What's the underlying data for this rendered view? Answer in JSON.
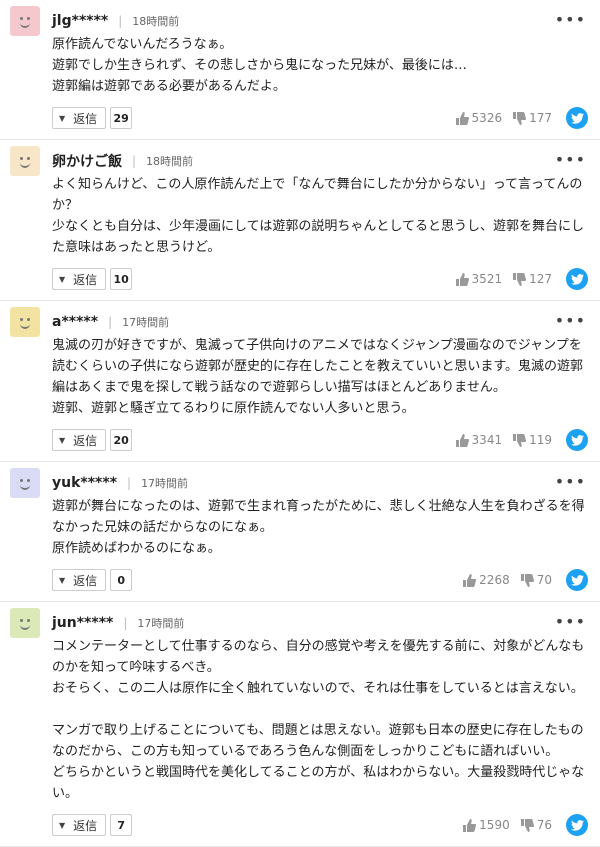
{
  "comments": [
    {
      "user": "jlg*****",
      "time": "18時間前",
      "avatar_color": "#f4c8cc",
      "body": "原作読んでないんだろうなぁ。\n遊郭でしか生きられず、その悲しさから鬼になった兄妹が、最後には…\n遊郭編は遊郭である必要があるんだよ。",
      "reply_label": "返信",
      "reply_count": "29",
      "likes": "5326",
      "dislikes": "177"
    },
    {
      "user": "卵かけご飯",
      "time": "18時間前",
      "avatar_color": "#f7e6c8",
      "body": "よく知らんけど、この人原作読んだ上で「なんで舞台にしたか分からない」って言ってんのか？\n少なくとも自分は、少年漫画にしては遊郭の説明ちゃんとしてると思うし、遊郭を舞台にした意味はあったと思うけど。",
      "reply_label": "返信",
      "reply_count": "10",
      "likes": "3521",
      "dislikes": "127"
    },
    {
      "user": "a*****",
      "time": "17時間前",
      "avatar_color": "#f3e3a2",
      "body": "鬼滅の刃が好きですが、鬼滅って子供向けのアニメではなくジャンプ漫画なのでジャンプを読むくらいの子供になら遊郭が歴史的に存在したことを教えていいと思います。鬼滅の遊郭編はあくまで鬼を探して戦う話なので遊郭らしい描写はほとんどありません。\n遊郭、遊郭と騒ぎ立てるわりに原作読んでない人多いと思う。",
      "reply_label": "返信",
      "reply_count": "20",
      "likes": "3341",
      "dislikes": "119"
    },
    {
      "user": "yuk*****",
      "time": "17時間前",
      "avatar_color": "#d9dcf4",
      "body": "遊郭が舞台になったのは、遊郭で生まれ育ったがために、悲しく壮絶な人生を負わざるを得なかった兄妹の話だからなのになぁ。\n原作読めばわかるのになぁ。",
      "reply_label": "返信",
      "reply_count": "0",
      "likes": "2268",
      "dislikes": "70"
    },
    {
      "user": "jun*****",
      "time": "17時間前",
      "avatar_color": "#dbe8b8",
      "body": "コメンテーターとして仕事するのなら、自分の感覚や考えを優先する前に、対象がどんなものかを知って吟味するべき。\nおそらく、この二人は原作に全く触れていないので、それは仕事をしているとは言えない。\n\nマンガで取り上げることについても、問題とは思えない。遊郭も日本の歴史に存在したものなのだから、この方も知っているであろう色んな側面をしっかりこどもに語ればいい。\nどちらかというと戦国時代を美化してることの方が、私はわからない。大量殺戮時代じゃない。",
      "reply_label": "返信",
      "reply_count": "7",
      "likes": "1590",
      "dislikes": "76"
    }
  ]
}
